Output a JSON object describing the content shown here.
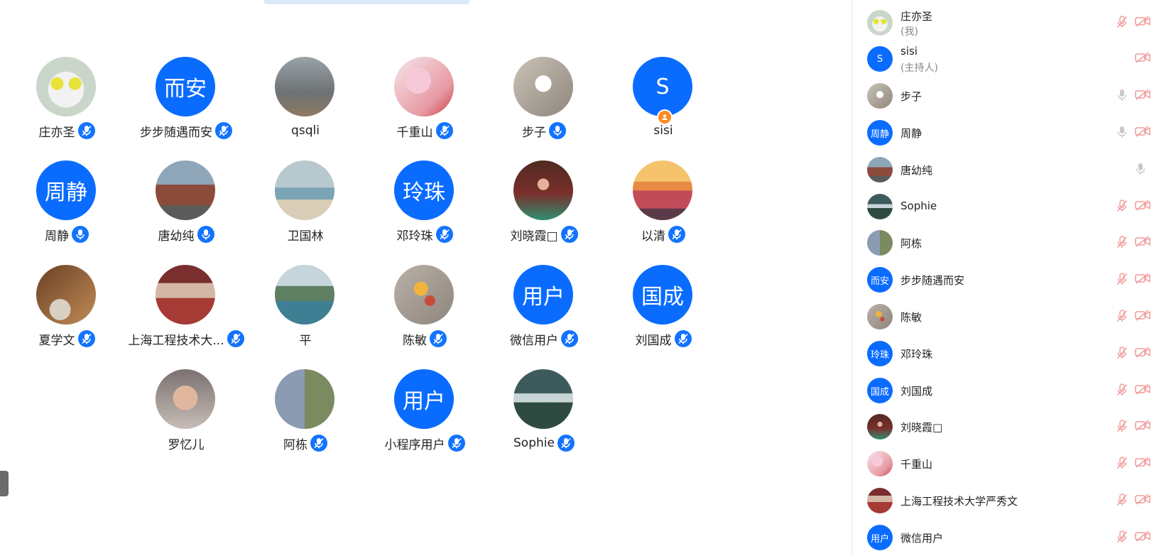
{
  "grid": [
    {
      "name": "庄亦圣",
      "avatar": "photo",
      "photo": "ultraman",
      "mic": true
    },
    {
      "name": "步步随遇而安",
      "avatar": "text",
      "label": "而安",
      "mic": true
    },
    {
      "name": "qsqli",
      "avatar": "photo",
      "photo": "man-grey",
      "mic": false
    },
    {
      "name": "千重山",
      "avatar": "photo",
      "photo": "kids",
      "mic": true
    },
    {
      "name": "步子",
      "avatar": "photo",
      "photo": "rabbit",
      "mic": true,
      "mic_plain": true
    },
    {
      "name": "sisi",
      "avatar": "text",
      "label": "S",
      "mic": false,
      "host": true
    },
    {
      "name": "周静",
      "avatar": "text",
      "label": "周静",
      "mic": true,
      "mic_plain": true
    },
    {
      "name": "唐幼纯",
      "avatar": "photo",
      "photo": "church",
      "mic": true,
      "mic_plain": true
    },
    {
      "name": "卫国林",
      "avatar": "photo",
      "photo": "beach",
      "mic": false
    },
    {
      "name": "邓玲珠",
      "avatar": "text",
      "label": "玲珠",
      "mic": true
    },
    {
      "name": "刘晓霞□",
      "avatar": "photo",
      "photo": "woman-red",
      "mic": true
    },
    {
      "name": "以清",
      "avatar": "photo",
      "photo": "sunset",
      "mic": true
    },
    {
      "name": "夏学文",
      "avatar": "photo",
      "photo": "tea",
      "mic": true
    },
    {
      "name": "上海工程技术大...",
      "avatar": "photo",
      "photo": "table",
      "mic": true
    },
    {
      "name": "平",
      "avatar": "photo",
      "photo": "lake",
      "mic": false
    },
    {
      "name": "陈敏",
      "avatar": "photo",
      "photo": "flower",
      "mic": true
    },
    {
      "name": "微信用户",
      "avatar": "text",
      "label": "用户",
      "mic": true
    },
    {
      "name": "刘国成",
      "avatar": "text",
      "label": "国成",
      "mic": true
    },
    {
      "name": "罗忆儿",
      "avatar": "photo",
      "photo": "granny",
      "mic": false
    },
    {
      "name": "阿栋",
      "avatar": "photo",
      "photo": "collage",
      "mic": true
    },
    {
      "name": "小程序用户",
      "avatar": "text",
      "label": "用户",
      "mic": true
    },
    {
      "name": "Sophie",
      "avatar": "photo",
      "photo": "waterfall",
      "mic": true
    }
  ],
  "panel": [
    {
      "name": "庄亦圣",
      "role": "(我)",
      "avatar": "photo",
      "photo": "ultraman",
      "mic": "muted",
      "cam": "off"
    },
    {
      "name": "sisi",
      "role": "(主持人)",
      "avatar": "text",
      "label": "S",
      "mic": "none",
      "cam": "off"
    },
    {
      "name": "步子",
      "avatar": "photo",
      "photo": "rabbit",
      "mic": "on",
      "cam": "off"
    },
    {
      "name": "周静",
      "avatar": "text",
      "label": "周静",
      "mic": "on",
      "cam": "off"
    },
    {
      "name": "唐幼纯",
      "avatar": "photo",
      "photo": "church",
      "mic": "none",
      "cam": "mic-only"
    },
    {
      "name": "Sophie",
      "avatar": "photo",
      "photo": "waterfall",
      "mic": "muted",
      "cam": "off"
    },
    {
      "name": "阿栋",
      "avatar": "photo",
      "photo": "collage",
      "mic": "muted",
      "cam": "off"
    },
    {
      "name": "步步随遇而安",
      "avatar": "text",
      "label": "而安",
      "mic": "muted",
      "cam": "off"
    },
    {
      "name": "陈敏",
      "avatar": "photo",
      "photo": "flower",
      "mic": "muted",
      "cam": "off"
    },
    {
      "name": "邓玲珠",
      "avatar": "text",
      "label": "玲珠",
      "mic": "muted",
      "cam": "off"
    },
    {
      "name": "刘国成",
      "avatar": "text",
      "label": "国成",
      "mic": "muted",
      "cam": "off"
    },
    {
      "name": "刘晓霞□",
      "avatar": "photo",
      "photo": "woman-red",
      "mic": "muted",
      "cam": "off"
    },
    {
      "name": "千重山",
      "avatar": "photo",
      "photo": "kids",
      "mic": "muted",
      "cam": "off"
    },
    {
      "name": "上海工程技术大学严秀文",
      "avatar": "photo",
      "photo": "table",
      "mic": "muted",
      "cam": "off"
    },
    {
      "name": "微信用户",
      "avatar": "text",
      "label": "用户",
      "mic": "muted",
      "cam": "off"
    }
  ],
  "colors": {
    "accent": "#0a6cff",
    "host_badge": "#ff8a1f",
    "icon_grey": "#c8c8c8",
    "mute_red": "#f29a9a"
  }
}
